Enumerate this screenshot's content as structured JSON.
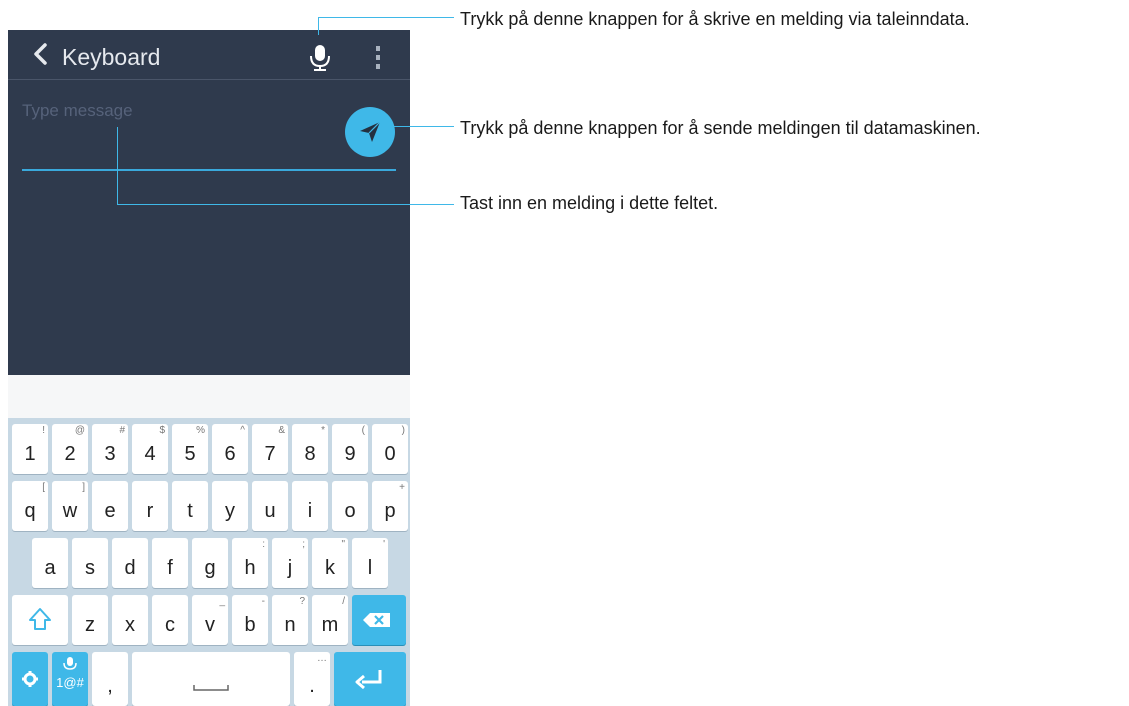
{
  "appbar": {
    "title": "Keyboard",
    "back_icon": "chevron-left-icon",
    "mic_icon": "microphone-icon",
    "more_icon": "more-vert-icon"
  },
  "compose": {
    "placeholder": "Type message",
    "value": "",
    "send_icon": "send-icon"
  },
  "colors": {
    "header_bg": "#2f3a4d",
    "accent": "#3fb8e8",
    "keyboard_bg": "#c7d8e4",
    "key_bg": "#ffffff"
  },
  "keyboard": {
    "row_numbers": [
      {
        "main": "1",
        "sec": "!"
      },
      {
        "main": "2",
        "sec": "@"
      },
      {
        "main": "3",
        "sec": "#"
      },
      {
        "main": "4",
        "sec": "$"
      },
      {
        "main": "5",
        "sec": "%"
      },
      {
        "main": "6",
        "sec": "^"
      },
      {
        "main": "7",
        "sec": "&"
      },
      {
        "main": "8",
        "sec": "*"
      },
      {
        "main": "9",
        "sec": "("
      },
      {
        "main": "0",
        "sec": ")"
      }
    ],
    "row_q": [
      {
        "main": "q",
        "sec": "["
      },
      {
        "main": "w",
        "sec": "]"
      },
      {
        "main": "e",
        "sec": ""
      },
      {
        "main": "r",
        "sec": ""
      },
      {
        "main": "t",
        "sec": ""
      },
      {
        "main": "y",
        "sec": ""
      },
      {
        "main": "u",
        "sec": ""
      },
      {
        "main": "i",
        "sec": ""
      },
      {
        "main": "o",
        "sec": ""
      },
      {
        "main": "p",
        "sec": "+"
      }
    ],
    "row_a": [
      {
        "main": "a",
        "sec": ""
      },
      {
        "main": "s",
        "sec": ""
      },
      {
        "main": "d",
        "sec": ""
      },
      {
        "main": "f",
        "sec": ""
      },
      {
        "main": "g",
        "sec": ""
      },
      {
        "main": "h",
        "sec": ":"
      },
      {
        "main": "j",
        "sec": ";"
      },
      {
        "main": "k",
        "sec": "\""
      },
      {
        "main": "l",
        "sec": "'"
      }
    ],
    "row_z": [
      {
        "main": "z",
        "sec": ""
      },
      {
        "main": "x",
        "sec": ""
      },
      {
        "main": "c",
        "sec": ""
      },
      {
        "main": "v",
        "sec": "_"
      },
      {
        "main": "b",
        "sec": "-"
      },
      {
        "main": "n",
        "sec": "?"
      },
      {
        "main": "m",
        "sec": "/"
      }
    ],
    "shift_icon": "shift-icon",
    "backspace_icon": "backspace-icon",
    "settings_icon": "gear-icon",
    "symbols_label": "1@#",
    "symbols_icon": "microphone-icon",
    "comma_label": ",",
    "space_icon": "space-bar-icon",
    "period_label": ".",
    "period_sec": "…",
    "enter_icon": "enter-icon"
  },
  "annotations": {
    "mic": "Trykk på denne knappen for å skrive en melding via taleinndata.",
    "send": "Trykk på denne knappen for å sende meldingen til datamaskinen.",
    "input": "Tast inn en melding i dette feltet."
  }
}
